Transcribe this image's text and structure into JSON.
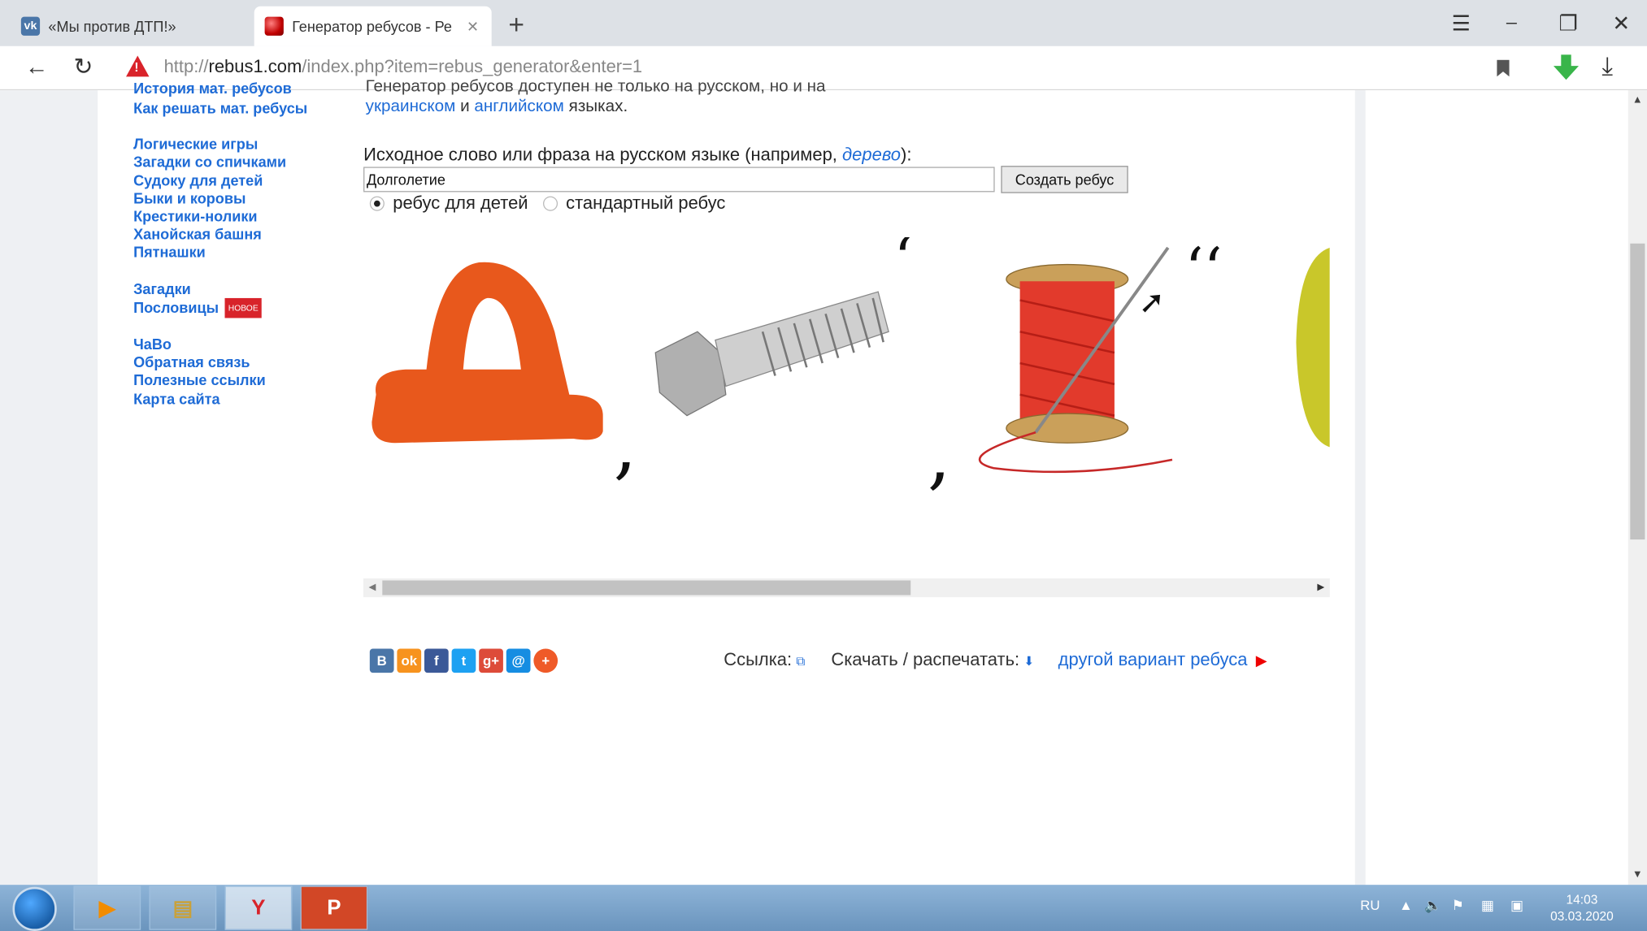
{
  "browser": {
    "tabs": [
      {
        "label": "«Мы против ДТП!»",
        "icon": "vk-icon"
      },
      {
        "label": "Генератор ребусов - Ре",
        "icon": "site-icon",
        "close": "✕"
      }
    ],
    "new_tab": "+",
    "window_controls": {
      "menu": "☰",
      "minimize": "⎯",
      "restore": "❐",
      "close": "✕"
    },
    "back": "←",
    "reload": "↻",
    "url_scheme": "http://",
    "url_host": "rebus1.com",
    "url_path": "/index.php?item=rebus_generator&enter=1"
  },
  "sidebar": {
    "cut_item": "История мат. ребусов",
    "groups": [
      [
        "Как решать мат. ребусы"
      ],
      [
        "Логические игры",
        "Загадки со спичками",
        "Судоку для детей",
        "Быки и коровы",
        "Крестики-нолики",
        "Ханойская башня",
        "Пятнашки"
      ],
      [
        "Загадки",
        "Пословицы"
      ],
      [
        "ЧаВо",
        "Обратная связь",
        "Полезные ссылки",
        "Карта сайта"
      ]
    ],
    "new_badge": "НОВОЕ"
  },
  "main": {
    "cut_text": "Генератор ребусов доступен не только на русском, но и на",
    "lang_ukr": "украинском",
    "lang_and": "и",
    "lang_eng": "английском",
    "lang_tail": "языках.",
    "question_prefix": "Исходное слово или фраза на русском языке (например,",
    "question_example": "дерево",
    "question_suffix": "):",
    "input_value": "Долголетие",
    "create_button": "Создать ребус",
    "radio_kids": "ребус для детей",
    "radio_standard": "стандартный ребус",
    "radio_selected": "kids"
  },
  "footer": {
    "social": [
      {
        "label": "B",
        "color": "#4a76a8",
        "icon": "vk-icon"
      },
      {
        "label": "ok",
        "color": "#f7931e",
        "icon": "odnoklassniki-icon"
      },
      {
        "label": "f",
        "color": "#3b5998",
        "icon": "facebook-icon"
      },
      {
        "label": "t",
        "color": "#1da1f2",
        "icon": "twitter-icon"
      },
      {
        "label": "g+",
        "color": "#dd4b39",
        "icon": "googleplus-icon"
      },
      {
        "label": "@",
        "color": "#168de2",
        "icon": "mail-icon"
      },
      {
        "label": "+",
        "color": "#ef5a28",
        "icon": "more-icon"
      }
    ],
    "link_label": "Ссылка:",
    "download_label": "Скачать / распечатать:",
    "other_variant": "другой вариант ребуса"
  },
  "taskbar": {
    "items": [
      "media-player-icon",
      "explorer-icon",
      "yandex-icon",
      "powerpoint-icon"
    ],
    "lang": "RU",
    "time": "14:03",
    "date": "03.03.2020"
  },
  "colors": {
    "link": "#1e6bd6",
    "accent_red": "#d8232a"
  }
}
